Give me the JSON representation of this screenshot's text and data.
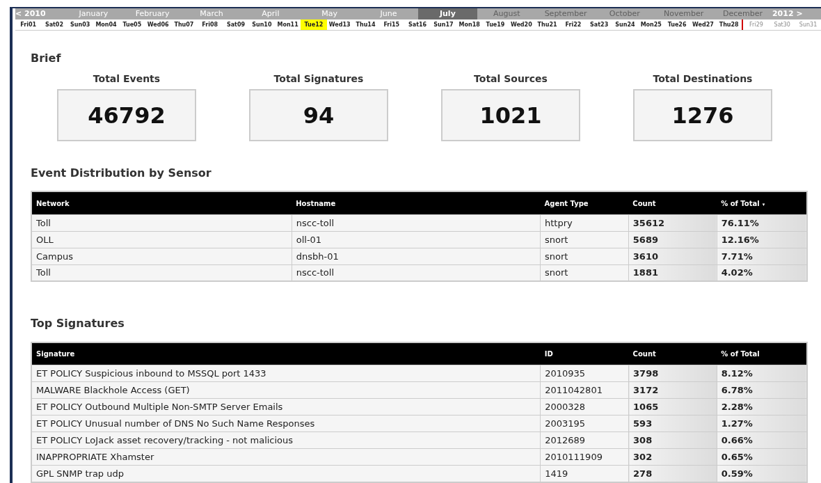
{
  "months": [
    {
      "label": "< 2010",
      "kind": "nav",
      "selected": false,
      "disabled": false
    },
    {
      "label": "January",
      "kind": "month",
      "selected": false,
      "disabled": false
    },
    {
      "label": "February",
      "kind": "month",
      "selected": false,
      "disabled": false
    },
    {
      "label": "March",
      "kind": "month",
      "selected": false,
      "disabled": false
    },
    {
      "label": "April",
      "kind": "month",
      "selected": false,
      "disabled": false
    },
    {
      "label": "May",
      "kind": "month",
      "selected": false,
      "disabled": false
    },
    {
      "label": "June",
      "kind": "month",
      "selected": false,
      "disabled": false
    },
    {
      "label": "July",
      "kind": "month",
      "selected": true,
      "disabled": false
    },
    {
      "label": "August",
      "kind": "month",
      "selected": false,
      "disabled": true
    },
    {
      "label": "September",
      "kind": "month",
      "selected": false,
      "disabled": true
    },
    {
      "label": "October",
      "kind": "month",
      "selected": false,
      "disabled": true
    },
    {
      "label": "November",
      "kind": "month",
      "selected": false,
      "disabled": true
    },
    {
      "label": "December",
      "kind": "month",
      "selected": false,
      "disabled": true
    },
    {
      "label": "2012 >",
      "kind": "nav",
      "selected": false,
      "disabled": false
    }
  ],
  "days": [
    {
      "label": "Fri01",
      "selected": false,
      "disabled": false
    },
    {
      "label": "Sat02",
      "selected": false,
      "disabled": false
    },
    {
      "label": "Sun03",
      "selected": false,
      "disabled": false
    },
    {
      "label": "Mon04",
      "selected": false,
      "disabled": false
    },
    {
      "label": "Tue05",
      "selected": false,
      "disabled": false
    },
    {
      "label": "Wed06",
      "selected": false,
      "disabled": false
    },
    {
      "label": "Thu07",
      "selected": false,
      "disabled": false
    },
    {
      "label": "Fri08",
      "selected": false,
      "disabled": false
    },
    {
      "label": "Sat09",
      "selected": false,
      "disabled": false
    },
    {
      "label": "Sun10",
      "selected": false,
      "disabled": false
    },
    {
      "label": "Mon11",
      "selected": false,
      "disabled": false
    },
    {
      "label": "Tue12",
      "selected": true,
      "disabled": false
    },
    {
      "label": "Wed13",
      "selected": false,
      "disabled": false
    },
    {
      "label": "Thu14",
      "selected": false,
      "disabled": false
    },
    {
      "label": "Fri15",
      "selected": false,
      "disabled": false
    },
    {
      "label": "Sat16",
      "selected": false,
      "disabled": false
    },
    {
      "label": "Sun17",
      "selected": false,
      "disabled": false
    },
    {
      "label": "Mon18",
      "selected": false,
      "disabled": false
    },
    {
      "label": "Tue19",
      "selected": false,
      "disabled": false
    },
    {
      "label": "Wed20",
      "selected": false,
      "disabled": false
    },
    {
      "label": "Thu21",
      "selected": false,
      "disabled": false
    },
    {
      "label": "Fri22",
      "selected": false,
      "disabled": false
    },
    {
      "label": "Sat23",
      "selected": false,
      "disabled": false
    },
    {
      "label": "Sun24",
      "selected": false,
      "disabled": false
    },
    {
      "label": "Mon25",
      "selected": false,
      "disabled": false
    },
    {
      "label": "Tue26",
      "selected": false,
      "disabled": false
    },
    {
      "label": "Wed27",
      "selected": false,
      "disabled": false
    },
    {
      "label": "Thu28",
      "selected": false,
      "disabled": false
    },
    {
      "label": "Fri29",
      "selected": false,
      "disabled": true
    },
    {
      "label": "Sat30",
      "selected": false,
      "disabled": true
    },
    {
      "label": "Sun31",
      "selected": false,
      "disabled": true
    }
  ],
  "brief": {
    "title": "Brief",
    "stats": [
      {
        "label": "Total Events",
        "value": "46792"
      },
      {
        "label": "Total Signatures",
        "value": "94"
      },
      {
        "label": "Total Sources",
        "value": "1021"
      },
      {
        "label": "Total Destinations",
        "value": "1276"
      }
    ]
  },
  "sensor_table": {
    "title": "Event Distribution by Sensor",
    "columns": [
      {
        "label": "Network",
        "emphasis": false
      },
      {
        "label": "Hostname",
        "emphasis": false
      },
      {
        "label": "Agent Type",
        "emphasis": false
      },
      {
        "label": "Count",
        "emphasis": true
      },
      {
        "label": "% of Total",
        "emphasis": true,
        "sort_mark": "▾"
      }
    ],
    "rows": [
      [
        "Toll",
        "nscc-toll",
        "httpry",
        "35612",
        "76.11%"
      ],
      [
        "OLL",
        "oll-01",
        "snort",
        "5689",
        "12.16%"
      ],
      [
        "Campus",
        "dnsbh-01",
        "snort",
        "3610",
        "7.71%"
      ],
      [
        "Toll",
        "nscc-toll",
        "snort",
        "1881",
        "4.02%"
      ]
    ]
  },
  "signature_table": {
    "title": "Top Signatures",
    "columns": [
      {
        "label": "Signature",
        "emphasis": false
      },
      {
        "label": "ID",
        "emphasis": false
      },
      {
        "label": "Count",
        "emphasis": true
      },
      {
        "label": "% of Total",
        "emphasis": true
      }
    ],
    "rows": [
      [
        "ET POLICY Suspicious inbound to MSSQL port 1433",
        "2010935",
        "3798",
        "8.12%"
      ],
      [
        "MALWARE Blackhole Access (GET)",
        "2011042801",
        "3172",
        "6.78%"
      ],
      [
        "ET POLICY Outbound Multiple Non-SMTP Server Emails",
        "2000328",
        "1065",
        "2.28%"
      ],
      [
        "ET POLICY Unusual number of DNS No Such Name Responses",
        "2003195",
        "593",
        "1.27%"
      ],
      [
        "ET POLICY LoJack asset recovery/tracking - not malicious",
        "2012689",
        "308",
        "0.66%"
      ],
      [
        "INAPPROPRIATE Xhamster",
        "2010111909",
        "302",
        "0.65%"
      ],
      [
        "GPL SNMP trap udp",
        "1419",
        "278",
        "0.59%"
      ]
    ]
  }
}
